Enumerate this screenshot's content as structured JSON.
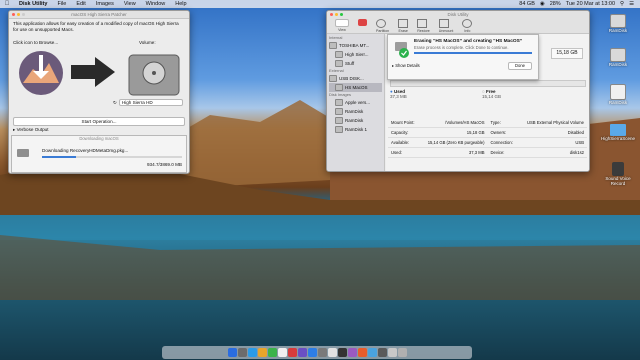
{
  "menubar": {
    "app": "Disk Utility",
    "items": [
      "File",
      "Edit",
      "Images",
      "View",
      "Window",
      "Help"
    ],
    "status": [
      "84 GB",
      "28%"
    ],
    "clock": "Tue 20 Mar at 13:00"
  },
  "creator": {
    "title": "macOS High Sierra Patcher",
    "description": "This application allows for easy creation of a modified copy of macOS High Sierra for use on unsupported Macs.",
    "browse_label": "Click icon to Browse...",
    "volume_label": "Volume:",
    "volume_value": "High Sierra HD",
    "start_button": "Start Operation...",
    "verbose_label": "Verbose Output",
    "sheet_title": "Downloading macOS",
    "download_file": "Downloading RecoveryHDMetaDmg.pkg...",
    "download_progress": "934.7/3869.0 MB",
    "download_fraction": 0.24
  },
  "disk_utility": {
    "title": "Disk Utility",
    "toolbar": [
      "View",
      "",
      "Partition",
      "Erase",
      "Restore",
      "Unmount",
      "Info"
    ],
    "sidebar": {
      "internal_header": "Internal",
      "internal_items": [
        "TOSHIBA MT...",
        "High Sierr...",
        "Stuff"
      ],
      "external_header": "External",
      "external_items": [
        "USB DISK...",
        "HS MacOS"
      ],
      "images_header": "Disk Images",
      "image_items": [
        "Apple vers...",
        "RamDisk",
        "RamDisk",
        "RamDisk 1"
      ]
    },
    "capacity": "15,18 GB",
    "erase_sheet": {
      "title": "Erasing “HS MacOS” and creating “HS MacOS”",
      "subtitle": "Erase process is complete. Click Done to continue.",
      "details": "Show Details",
      "done": "Done"
    },
    "used_label": "Used",
    "used_value": "37,3 MB",
    "free_label": "Free",
    "free_value": "15,14 GB",
    "info_left": [
      [
        "Mount Point:",
        "/Volumes/HS MacOS"
      ],
      [
        "Capacity:",
        "15,18 GB"
      ],
      [
        "Available:",
        "15,14 GB (Zero KB purgeable)"
      ],
      [
        "Used:",
        "37,3 MB"
      ]
    ],
    "info_right": [
      [
        "Type:",
        "USB External Physical Volume"
      ],
      [
        "Owners:",
        "Disabled"
      ],
      [
        "Connection:",
        "USB"
      ],
      [
        "Device:",
        "disk1s2"
      ]
    ]
  },
  "desktop_icons": [
    "RamDisk",
    "RamDisk",
    "RamDisk",
    "HighSierraScene",
    "Sound Voice Record"
  ],
  "colors": {
    "accent": "#3a7bd5",
    "success": "#2bb24c"
  }
}
